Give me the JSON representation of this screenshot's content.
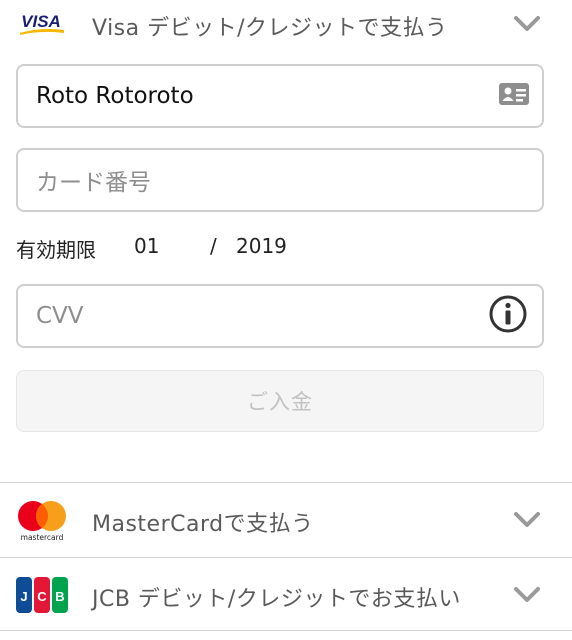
{
  "payment_methods": {
    "visa": {
      "logo_text": "VISA",
      "label": "Visa デビット/クレジットで支払う",
      "icon": "visa-logo",
      "expanded": true
    },
    "mastercard": {
      "logo_text": "mastercard",
      "label": "MasterCardで支払う",
      "icon": "mastercard-logo",
      "expanded": false
    },
    "jcb": {
      "logo_text": "JCB",
      "label": "JCB デビット/クレジットでお支払い",
      "icon": "jcb-logo",
      "expanded": false
    }
  },
  "form": {
    "cardholder_name": {
      "value": "Roto Rotoroto",
      "icon": "id-card-icon"
    },
    "card_number": {
      "value": "",
      "placeholder": "カード番号"
    },
    "expiry": {
      "label": "有効期限",
      "month": "01",
      "separator": "/",
      "year": "2019"
    },
    "cvv": {
      "value": "",
      "placeholder": "CVV",
      "icon": "info-icon"
    },
    "submit_label": "ご入金",
    "submit_enabled": false
  },
  "colors": {
    "border": "#cfcfcf",
    "text_label": "#5a5a5a",
    "disabled_text": "#c2c2c2",
    "visa_blue": "#1a1f71",
    "visa_gold": "#f7b600",
    "mc_red": "#eb001b",
    "mc_orange": "#f79e1b"
  }
}
